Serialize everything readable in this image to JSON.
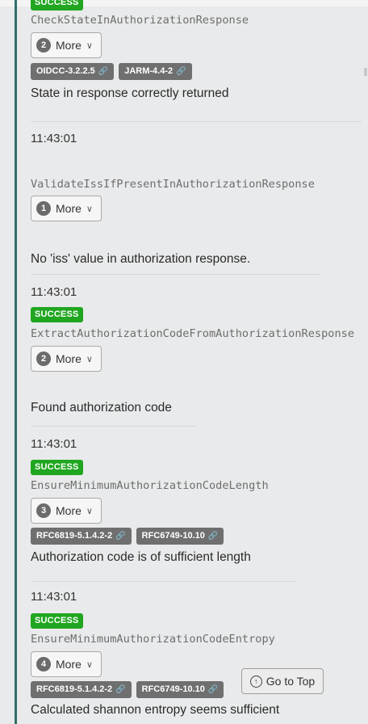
{
  "go_to_top_label": "Go to Top",
  "entries": [
    {
      "time": "",
      "badge": "SUCCESS",
      "condition": "CheckStateInAuthorizationResponse",
      "more_count": "2",
      "more_label": "More",
      "refs": [
        "OIDCC-3.2.2.5",
        "JARM-4.4-2"
      ],
      "message": "State in response correctly returned"
    },
    {
      "time": "11:43:01",
      "badge": "",
      "condition": "ValidateIssIfPresentInAuthorizationResponse",
      "more_count": "1",
      "more_label": "More",
      "refs": [],
      "message": "No 'iss' value in authorization response."
    },
    {
      "time": "11:43:01",
      "badge": "SUCCESS",
      "condition": "ExtractAuthorizationCodeFromAuthorizationResponse",
      "more_count": "2",
      "more_label": "More",
      "refs": [],
      "message": "Found authorization code"
    },
    {
      "time": "11:43:01",
      "badge": "SUCCESS",
      "condition": "EnsureMinimumAuthorizationCodeLength",
      "more_count": "3",
      "more_label": "More",
      "refs": [
        "RFC6819-5.1.4.2-2",
        "RFC6749-10.10"
      ],
      "message": "Authorization code is of sufficient length"
    },
    {
      "time": "11:43:01",
      "badge": "SUCCESS",
      "condition": "EnsureMinimumAuthorizationCodeEntropy",
      "more_count": "4",
      "more_label": "More",
      "refs": [
        "RFC6819-5.1.4.2-2",
        "RFC6749-10.10"
      ],
      "message": "Calculated shannon entropy seems sufficient"
    }
  ]
}
